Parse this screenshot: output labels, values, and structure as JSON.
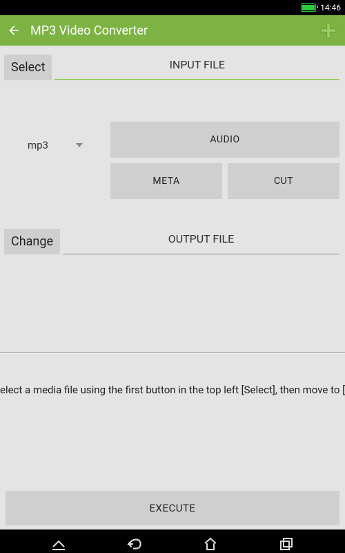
{
  "status": {
    "time": "14:46"
  },
  "appbar": {
    "title": "MP3 Video Converter"
  },
  "input_section": {
    "select_label": "Select",
    "header": "INPUT FILE"
  },
  "format": {
    "selected": "mp3"
  },
  "buttons": {
    "audio": "AUDIO",
    "meta": "META",
    "cut": "CUT"
  },
  "output_section": {
    "change_label": "Change",
    "header": "OUTPUT FILE"
  },
  "instruction_text": "elect a media file using the first button in the top left [Select], then move to [EXECUTE",
  "execute_label": "EXECUTE"
}
